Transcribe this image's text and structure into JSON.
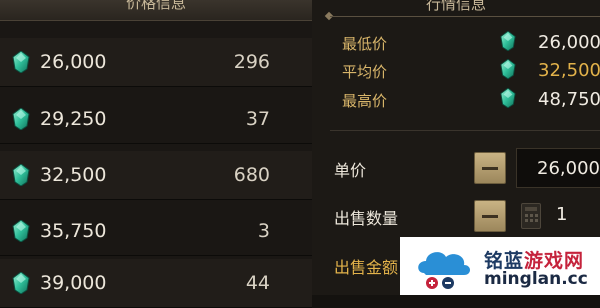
{
  "price_list": {
    "header": "价格信息",
    "rows": [
      {
        "price": "26,000",
        "qty": "296"
      },
      {
        "price": "29,250",
        "qty": "37"
      },
      {
        "price": "32,500",
        "qty": "680"
      },
      {
        "price": "35,750",
        "qty": "3"
      },
      {
        "price": "39,000",
        "qty": "44"
      }
    ]
  },
  "trade_info": {
    "header": "行情信息",
    "stats": [
      {
        "label": "最低价",
        "value": "26,000",
        "color": "#f0ebe2"
      },
      {
        "label": "平均价",
        "value": "32,500",
        "color": "#e2b24a"
      },
      {
        "label": "最高价",
        "value": "48,750",
        "color": "#f0ebe2"
      }
    ]
  },
  "sell_form": {
    "unit_price_label": "单价",
    "unit_price_value": "26,000",
    "quantity_label": "出售数量",
    "quantity_value": "1",
    "total_label": "出售金额"
  },
  "watermark": {
    "brand_cn_main": "铭蓝",
    "brand_cn_sub": "游戏网",
    "brand_en": "minglan.cc"
  },
  "colors": {
    "gem": "#2fbf9a",
    "gold_label": "#d8b56a",
    "accent_gold": "#e2b24a"
  },
  "icons": {
    "currency": "green-gem-icon",
    "minus": "minus-icon",
    "calculator": "calculator-icon"
  }
}
